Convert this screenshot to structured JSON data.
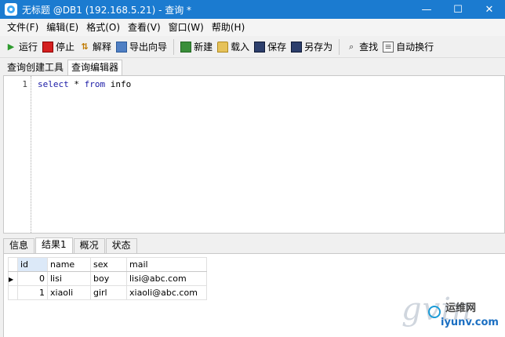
{
  "window": {
    "title": "无标题 @DB1 (192.168.5.21) - 查询 *",
    "minimize": "—",
    "maximize": "☐",
    "close": "✕"
  },
  "menu": [
    "文件(F)",
    "编辑(E)",
    "格式(O)",
    "查看(V)",
    "窗口(W)",
    "帮助(H)"
  ],
  "toolbar": {
    "run": "运行",
    "stop": "停止",
    "explain": "解释",
    "export_wizard": "导出向导",
    "new": "新建",
    "load": "载入",
    "save": "保存",
    "save_as": "另存为",
    "find": "查找",
    "word_wrap": "自动换行"
  },
  "editor_tabs": [
    "查询创建工具",
    "查询编辑器"
  ],
  "editor": {
    "line_number": "1",
    "code_tokens": [
      "select",
      " * ",
      "from",
      " info"
    ]
  },
  "result_tabs": [
    "信息",
    "结果1",
    "概况",
    "状态"
  ],
  "result_table": {
    "columns": [
      "id",
      "name",
      "sex",
      "mail"
    ],
    "rows": [
      [
        "0",
        "lisi",
        "boy",
        "lisi@abc.com"
      ],
      [
        "1",
        "xiaoli",
        "girl",
        "xiaoli@abc.com"
      ]
    ],
    "current_row_marker": "▶"
  },
  "watermark": {
    "big": "gvin",
    "site_name": "运维网",
    "url": "iyunv.com"
  },
  "colors": {
    "titlebar": "#1b7bd0",
    "keyword": "#1a1aa6",
    "selected_header": "#dce9f8"
  }
}
